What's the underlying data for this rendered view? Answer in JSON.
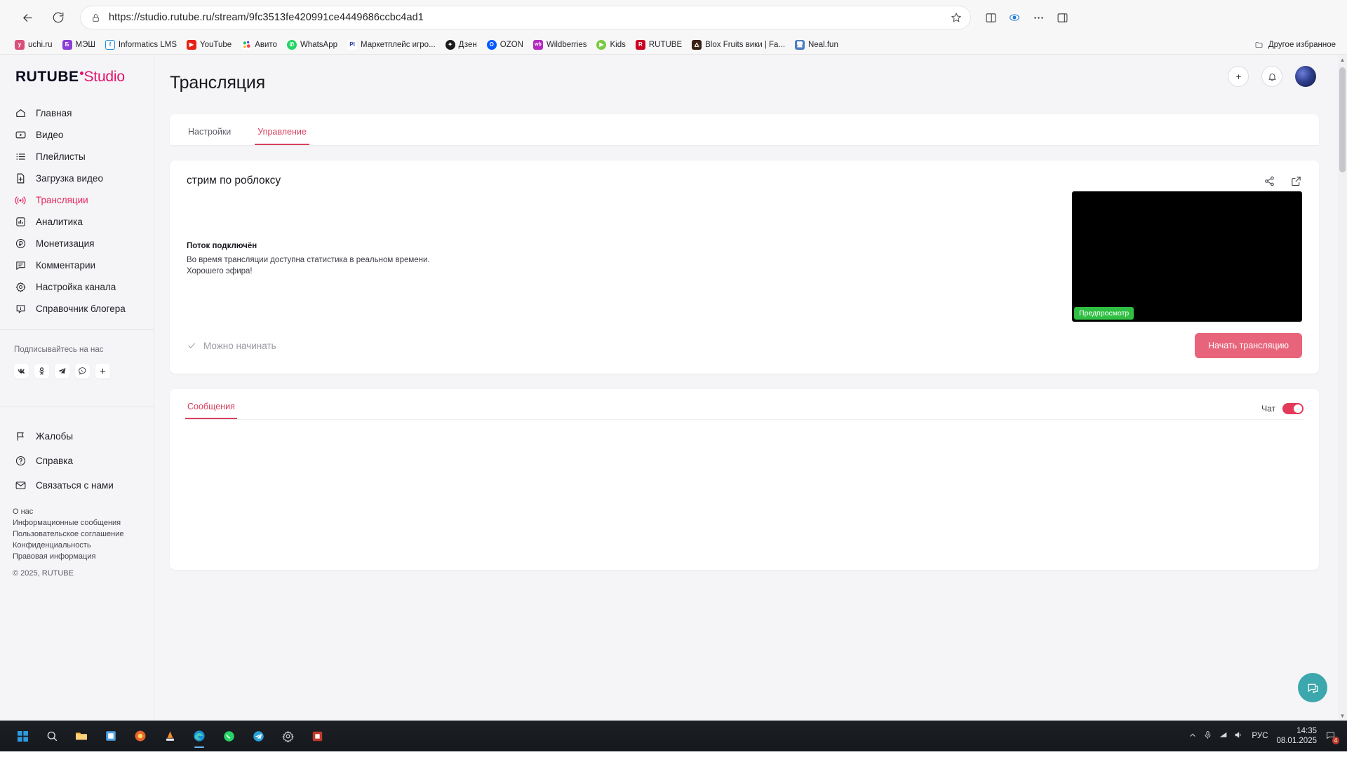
{
  "browser": {
    "url": "https://studio.rutube.ru/stream/9fc3513fe420991ce4449686ccbc4ad1",
    "back_label": "back-arrow",
    "reload_label": "reload",
    "bookmarks": [
      {
        "label": "uchi.ru",
        "icon": "uchiru-icon",
        "color": "#d94f7a"
      },
      {
        "label": "МЭШ",
        "icon": "mesh-icon",
        "color": "#8c3fd6"
      },
      {
        "label": "Informatics LMS",
        "icon": "informatics-icon",
        "color": "#1f8fd8"
      },
      {
        "label": "YouTube",
        "icon": "youtube-icon",
        "color": "#e62117"
      },
      {
        "label": "Авито",
        "icon": "avito-icon",
        "color": "#3ba84a"
      },
      {
        "label": "WhatsApp",
        "icon": "whatsapp-icon",
        "color": "#25d366"
      },
      {
        "label": "Маркетплейс игро...",
        "icon": "pi-icon",
        "color": "#2f3ea8"
      },
      {
        "label": "Дзен",
        "icon": "dzen-icon",
        "color": "#1a1a1a"
      },
      {
        "label": "OZON",
        "icon": "ozon-icon",
        "color": "#0059ff"
      },
      {
        "label": "Wildberries",
        "icon": "wildberries-icon",
        "color": "#b429bf"
      },
      {
        "label": "Kids",
        "icon": "kids-icon",
        "color": "#7ac943"
      },
      {
        "label": "RUTUBE",
        "icon": "rutube-icon",
        "color": "#cc0022"
      },
      {
        "label": "Blox Fruits вики | Fa...",
        "icon": "fandom-icon",
        "color": "#3a1f12"
      },
      {
        "label": "Neal.fun",
        "icon": "nealfun-icon",
        "color": "#4b7ebf"
      }
    ],
    "other_bookmarks": "Другое избранное"
  },
  "sidebar": {
    "logo": {
      "rutube": "RUTUBE",
      "studio": "Studio"
    },
    "items": [
      {
        "label": "Главная",
        "icon": "home-icon"
      },
      {
        "label": "Видео",
        "icon": "video-icon"
      },
      {
        "label": "Плейлисты",
        "icon": "playlist-icon"
      },
      {
        "label": "Загрузка видео",
        "icon": "upload-icon"
      },
      {
        "label": "Трансляции",
        "icon": "broadcast-icon",
        "active": true
      },
      {
        "label": "Аналитика",
        "icon": "analytics-icon"
      },
      {
        "label": "Монетизация",
        "icon": "ruble-icon"
      },
      {
        "label": "Комментарии",
        "icon": "comment-icon"
      },
      {
        "label": "Настройка канала",
        "icon": "gear-icon"
      },
      {
        "label": "Справочник блогера",
        "icon": "info-icon"
      }
    ],
    "subscribe_title": "Подписывайтесь на нас",
    "socials": [
      {
        "name": "vk-icon"
      },
      {
        "name": "odnoklassniki-icon"
      },
      {
        "name": "telegram-icon"
      },
      {
        "name": "viber-icon"
      },
      {
        "name": "plus-icon"
      }
    ],
    "bottom_items": [
      {
        "label": "Жалобы",
        "icon": "flag-icon"
      },
      {
        "label": "Справка",
        "icon": "question-icon"
      },
      {
        "label": "Связаться с нами",
        "icon": "mail-icon"
      }
    ],
    "legal_links": [
      "О нас",
      "Информационные сообщения",
      "Пользовательское соглашение",
      "Конфиденциальность",
      "Правовая информация"
    ],
    "copyright": "© 2025, RUTUBE"
  },
  "header": {
    "add_icon": "add-video-icon",
    "bell_icon": "notification-bell-icon",
    "avatar": "user-avatar"
  },
  "main": {
    "page_title": "Трансляция",
    "tabs": [
      {
        "label": "Настройки",
        "active": false
      },
      {
        "label": "Управление",
        "active": true
      }
    ],
    "stream": {
      "name": "стрим по роблоксу",
      "share_icon": "share-icon",
      "open-external_icon": "open-external-icon",
      "status_title": "Поток подключён",
      "status_line1": "Во время трансляции доступна статистика в реальном времени.",
      "status_line2": "Хорошего эфира!",
      "preview_badge": "Предпросмотр",
      "ready_label": "Можно начинать",
      "start_button": "Начать трансляцию",
      "accent_color": "#e8647a",
      "badge_color": "#2fbf43"
    },
    "chat": {
      "tab_label": "Сообщения",
      "toggle_label": "Чат",
      "toggle_on": true,
      "toggle_color": "#e33a5c"
    },
    "fab_icon": "feedback-icon"
  },
  "taskbar": {
    "items": [
      {
        "name": "start-windows-icon"
      },
      {
        "name": "search-icon"
      },
      {
        "name": "file-explorer-icon"
      },
      {
        "name": "store-icon"
      },
      {
        "name": "browser-alt-icon"
      },
      {
        "name": "vlc-icon"
      },
      {
        "name": "edge-icon",
        "active": true
      },
      {
        "name": "whatsapp-icon"
      },
      {
        "name": "telegram-icon"
      },
      {
        "name": "settings-icon"
      },
      {
        "name": "app-icon"
      }
    ],
    "tray": {
      "chevron": "show-hidden-icons",
      "mic": "microphone-icon",
      "network": "network-icon",
      "volume": "volume-icon",
      "language": "РУС",
      "time": "14:35",
      "date": "08.01.2025",
      "notification_count": "4"
    }
  }
}
